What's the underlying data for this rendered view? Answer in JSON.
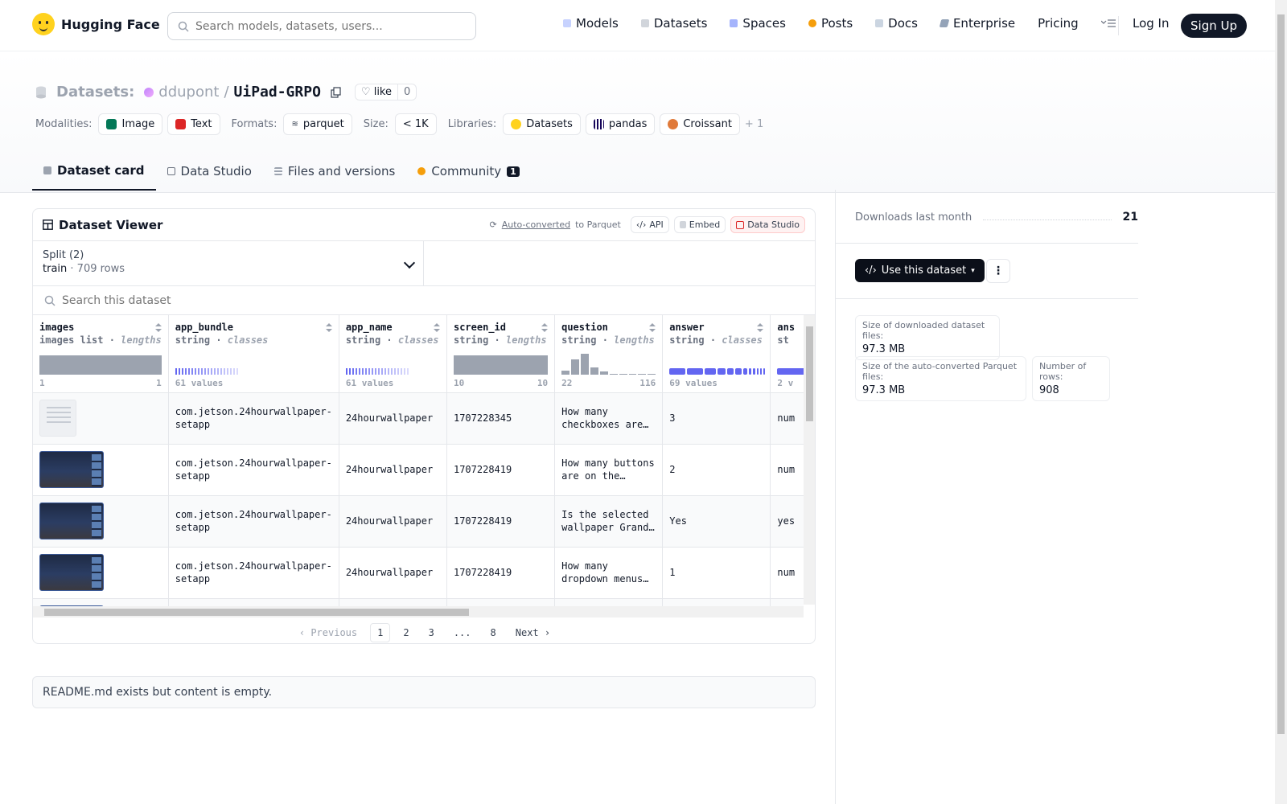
{
  "nav": {
    "logo": "Hugging Face",
    "search_placeholder": "Search models, datasets, users...",
    "links": [
      "Models",
      "Datasets",
      "Spaces",
      "Posts",
      "Docs",
      "Enterprise",
      "Pricing"
    ],
    "login": "Log In",
    "signup": "Sign Up"
  },
  "header": {
    "section": "Datasets:",
    "owner": "ddupont",
    "slash": "/",
    "repo": "UiPad-GRPO",
    "like_label": "like",
    "like_count": "0",
    "modalities_label": "Modalities:",
    "modalities": [
      "Image",
      "Text"
    ],
    "formats_label": "Formats:",
    "format": "parquet",
    "size_label": "Size:",
    "size": "< 1K",
    "libraries_label": "Libraries:",
    "libraries": [
      "Datasets",
      "pandas",
      "Croissant"
    ],
    "libraries_more": "+ 1"
  },
  "tabs": [
    {
      "label": "Dataset card"
    },
    {
      "label": "Data Studio"
    },
    {
      "label": "Files and versions"
    },
    {
      "label": "Community",
      "badge": "1"
    }
  ],
  "viewer": {
    "title": "Dataset Viewer",
    "autoconverted": "Auto-converted",
    "to_parquet": "to Parquet",
    "api": "API",
    "embed": "Embed",
    "data_studio": "Data Studio",
    "split_label": "Split (2)",
    "split_name": "train",
    "split_rows": "709 rows",
    "search_placeholder": "Search this dataset",
    "columns": [
      {
        "name": "images",
        "type": "images list",
        "stat": "lengths",
        "min": "1",
        "max": "1"
      },
      {
        "name": "app_bundle",
        "type": "string",
        "stat": "classes",
        "info": "61 values"
      },
      {
        "name": "app_name",
        "type": "string",
        "stat": "classes",
        "info": "61 values"
      },
      {
        "name": "screen_id",
        "type": "string",
        "stat": "lengths",
        "min": "10",
        "max": "10"
      },
      {
        "name": "question",
        "type": "string",
        "stat": "lengths",
        "min": "22",
        "max": "116"
      },
      {
        "name": "answer",
        "type": "string",
        "stat": "classes",
        "info": "69 values"
      },
      {
        "name": "ans",
        "type": "st",
        "stat": "",
        "info": "2 v"
      }
    ],
    "rows": [
      {
        "app_bundle": "com.jetson.24hourwallpaper-setapp",
        "app_name": "24hourwallpaper",
        "screen_id": "1707228345",
        "question": "How many checkboxes are on the screen?",
        "answer": "3",
        "ans": "num"
      },
      {
        "app_bundle": "com.jetson.24hourwallpaper-setapp",
        "app_name": "24hourwallpaper",
        "screen_id": "1707228419",
        "question": "How many buttons are on the screen?",
        "answer": "2",
        "ans": "num"
      },
      {
        "app_bundle": "com.jetson.24hourwallpaper-setapp",
        "app_name": "24hourwallpaper",
        "screen_id": "1707228419",
        "question": "Is the selected wallpaper Grand Canyon?",
        "answer": "Yes",
        "ans": "yes"
      },
      {
        "app_bundle": "com.jetson.24hourwallpaper-setapp",
        "app_name": "24hourwallpaper",
        "screen_id": "1707228419",
        "question": "How many dropdown menus are on the screen?",
        "answer": "1",
        "ans": "num"
      }
    ],
    "pager": {
      "prev": "Previous",
      "pages": [
        "1",
        "2",
        "3",
        "...",
        "8"
      ],
      "next": "Next"
    }
  },
  "readme": "README.md exists but content is empty.",
  "sidebar": {
    "downloads_label": "Downloads last month",
    "downloads": "21",
    "use_button": "Use this dataset",
    "size_dl_label": "Size of downloaded dataset files:",
    "size_dl": "97.3 MB",
    "size_parquet_label": "Size of the auto-converted Parquet files:",
    "size_parquet": "97.3 MB",
    "rows_label": "Number of rows:",
    "rows": "908"
  }
}
